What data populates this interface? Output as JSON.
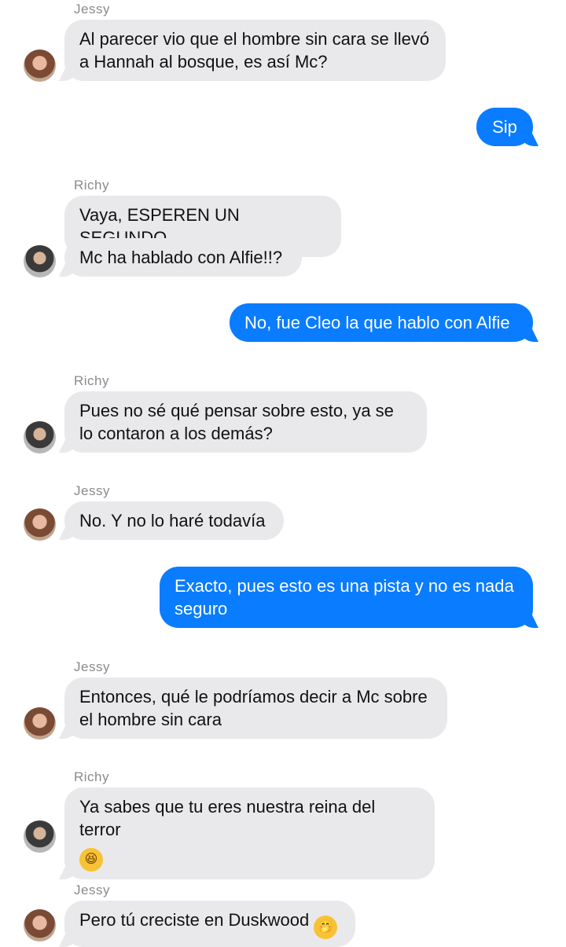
{
  "chat": {
    "contacts": {
      "jessy": {
        "name": "Jessy",
        "avatar_icon": "jessy-avatar-photo"
      },
      "richy": {
        "name": "Richy",
        "avatar_icon": "richy-avatar-photo"
      }
    },
    "messages": [
      {
        "from": "Jessy",
        "direction": "incoming",
        "text": "Al parecer vio que el hombre sin cara se llevó a Hannah al bosque, es así Mc?"
      },
      {
        "from": "Mc",
        "direction": "outgoing",
        "text": "Sip"
      },
      {
        "from": "Richy",
        "direction": "incoming",
        "text": "Vaya, ESPEREN UN SEGUNDO"
      },
      {
        "from": "Richy",
        "direction": "incoming",
        "text": "Mc ha hablado con Alfie!!?"
      },
      {
        "from": "Mc",
        "direction": "outgoing",
        "text": "No, fue Cleo la que hablo con Alfie"
      },
      {
        "from": "Richy",
        "direction": "incoming",
        "text": "Pues no sé qué pensar sobre esto, ya se lo contaron a los demás?"
      },
      {
        "from": "Jessy",
        "direction": "incoming",
        "text": "No. Y no lo haré todavía"
      },
      {
        "from": "Mc",
        "direction": "outgoing",
        "text": "Exacto, pues esto es una pista y no es nada seguro"
      },
      {
        "from": "Jessy",
        "direction": "incoming",
        "text": "Entonces, qué le podríamos decir a Mc sobre el hombre sin cara"
      },
      {
        "from": "Richy",
        "direction": "incoming",
        "text": "Ya sabes que tu eres nuestra reina del terror",
        "emoji": "grinning-squinting-face-emoji",
        "emoji_glyph": "😆"
      },
      {
        "from": "Jessy",
        "direction": "incoming",
        "text": "Pero tú creciste en Duskwood",
        "emoji": "face-with-hand-over-mouth-emoji",
        "emoji_glyph": "🤭"
      }
    ]
  },
  "colors": {
    "outgoing_bubble": "#0a7cff",
    "incoming_bubble": "#e9e9eb",
    "sender_label": "#8a8a8e"
  }
}
